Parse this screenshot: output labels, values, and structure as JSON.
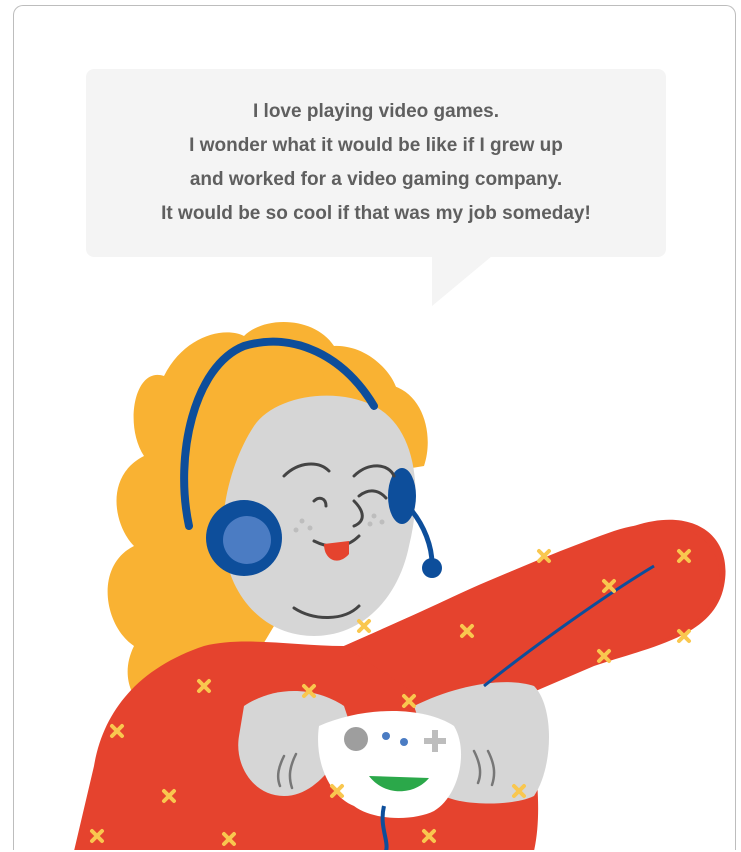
{
  "speech_bubble": {
    "lines": [
      "I love playing video games.",
      "I wonder what it would be like if I grew up",
      "and worked for a video gaming company.",
      "It would be so cool if that was my job someday!"
    ]
  },
  "colors": {
    "hair": "#F9B233",
    "skin": "#D6D6D6",
    "shirt": "#E5432E",
    "shirt_pattern": "#F9C74F",
    "headset": "#0D4E9B",
    "headset_cup": "#4B7CC3",
    "controller": "#FFFFFF",
    "controller_accent": "#2BA84A",
    "tongue": "#E5432E"
  }
}
